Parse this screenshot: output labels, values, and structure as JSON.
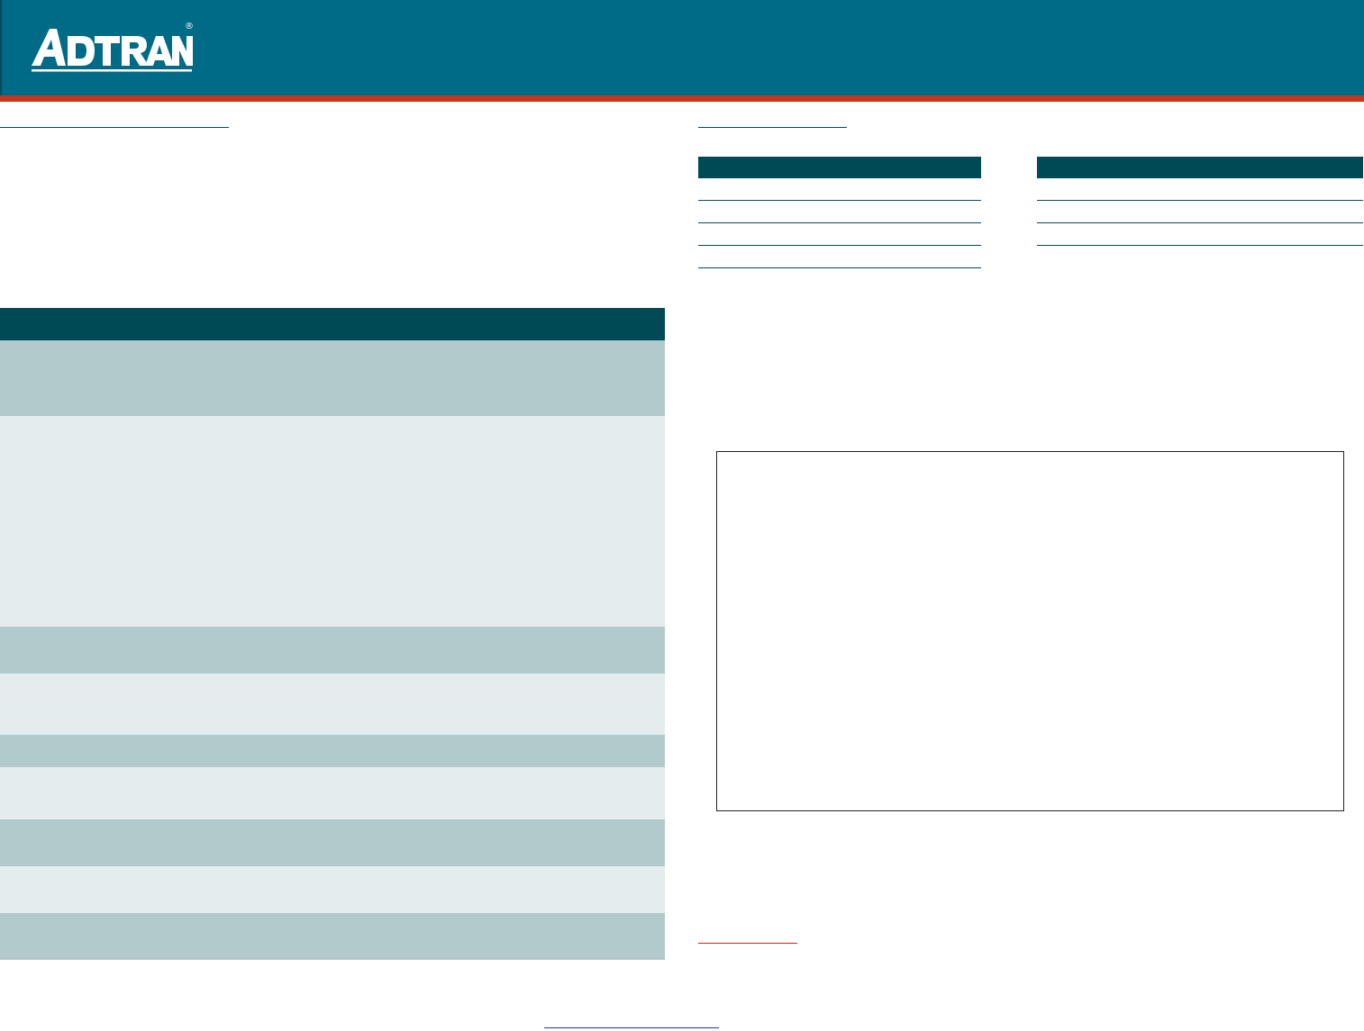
{
  "brand": {
    "logo_text": "ADTRAN",
    "registered_mark": "®",
    "colors": {
      "header": "#006b87",
      "accent_stripe": "#c8361b",
      "table_header": "#004a55",
      "row_dark": "#b3cacc",
      "row_light": "#e4eced",
      "link_red": "#d01f1f",
      "link_blue": "#2430c8"
    }
  },
  "left_section": {
    "heading": ""
  },
  "right_section": {
    "heading": ""
  },
  "spec_tables": [
    {
      "header": "",
      "rows": [
        "",
        "",
        "",
        ""
      ]
    },
    {
      "header": "",
      "rows": [
        "",
        "",
        ""
      ]
    }
  ],
  "feature_table": {
    "header": "",
    "rows": [
      "",
      "",
      "",
      "",
      "",
      "",
      "",
      "",
      ""
    ]
  },
  "figure": {
    "caption": ""
  },
  "footer": {
    "link_text": "",
    "web_link_text": ""
  }
}
